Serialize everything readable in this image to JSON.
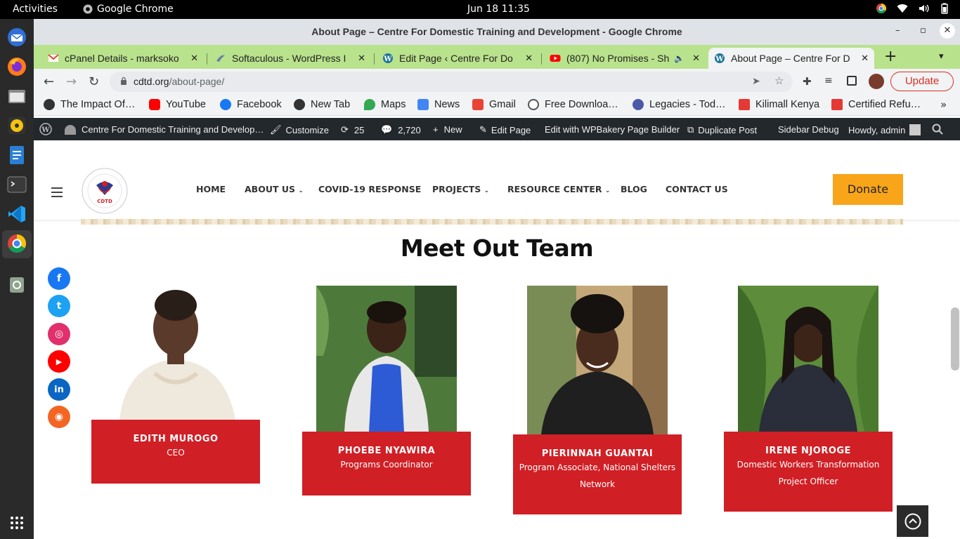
{
  "system": {
    "activities": "Activities",
    "app_name": "Google Chrome",
    "clock": "Jun 18  11:35"
  },
  "window": {
    "title": "About Page – Centre For Domestic Training and Development - Google Chrome"
  },
  "tabs": [
    {
      "label": "cPanel Details - marksoko",
      "icon": "gmail-icon",
      "color": "#ea4335"
    },
    {
      "label": "Softaculous - WordPress I",
      "icon": "softaculous-icon",
      "color": "#6b7fa8"
    },
    {
      "label": "Edit Page ‹ Centre For Do",
      "icon": "wordpress-icon",
      "color": "#21759b"
    },
    {
      "label": "(807) No Promises - Sh",
      "icon": "youtube-icon",
      "color": "#ff0000"
    },
    {
      "label": "About Page – Centre For D",
      "icon": "wordpress-icon",
      "color": "#21759b"
    }
  ],
  "toolbar": {
    "url_host": "cdtd.org",
    "url_path": "/about-page/",
    "update_label": "Update"
  },
  "bookmarks": [
    {
      "label": "The Impact Of…",
      "icon": "globe-icon",
      "color": "#333333"
    },
    {
      "label": "YouTube",
      "icon": "youtube-icon",
      "color": "#ff0000"
    },
    {
      "label": "Facebook",
      "icon": "facebook-icon",
      "color": "#1877f2"
    },
    {
      "label": "New Tab",
      "icon": "globe-icon",
      "color": "#333333"
    },
    {
      "label": "Maps",
      "icon": "maps-icon",
      "color": "#34a853"
    },
    {
      "label": "News",
      "icon": "news-icon",
      "color": "#4285f4"
    },
    {
      "label": "Gmail",
      "icon": "gmail-icon",
      "color": "#ea4335"
    },
    {
      "label": "Free Downloa…",
      "icon": "film-icon",
      "color": "#555555"
    },
    {
      "label": "Legacies - Tod…",
      "icon": "legacies-icon",
      "color": "#4a5aa8"
    },
    {
      "label": "Kilimall Kenya",
      "icon": "kilimall-icon",
      "color": "#e53935"
    },
    {
      "label": "Certified Refu…",
      "icon": "kilimall-icon",
      "color": "#e53935"
    }
  ],
  "wpbar": {
    "site_name": "Centre For Domestic Training and Develop…",
    "customize": "Customize",
    "updates": "25",
    "comments": "2,720",
    "new": "New",
    "edit_page": "Edit Page",
    "wpbakery": "Edit with WPBakery Page Builder",
    "duplicate": "Duplicate Post",
    "sidebar_debug": "Sidebar Debug",
    "howdy": "Howdy, admin"
  },
  "site": {
    "logo_text": "CDTD",
    "logo_ring_text": "Centre for Domestic Training and Development",
    "menu": [
      "HOME",
      "ABOUT US",
      "COVID-19 RESPONSE",
      "PROJECTS",
      "RESOURCE CENTER",
      "BLOG",
      "CONTACT US"
    ],
    "donate": "Donate",
    "team_title": "Meet Out Team",
    "social": [
      {
        "name": "facebook-icon",
        "glyph": "f",
        "color": "#1877f2"
      },
      {
        "name": "twitter-icon",
        "glyph": "t",
        "color": "#1da1f2"
      },
      {
        "name": "instagram-icon",
        "glyph": "◎",
        "color": "#e1306c"
      },
      {
        "name": "youtube-icon",
        "glyph": "▶",
        "color": "#ff0000"
      },
      {
        "name": "linkedin-icon",
        "glyph": "in",
        "color": "#0a66c2"
      },
      {
        "name": "rss-icon",
        "glyph": "◉",
        "color": "#f26522"
      }
    ],
    "team": [
      {
        "name": "EDITH MUROGO",
        "role": "CEO"
      },
      {
        "name": "PHOEBE NYAWIRA",
        "role": "Programs Coordinator"
      },
      {
        "name": "PIERINNAH GUANTAI",
        "role": "Program Associate, National Shelters Network"
      },
      {
        "name": "IRENE NJOROGE",
        "role": "Domestic Workers Transformation Project Officer"
      }
    ]
  },
  "colors": {
    "accent_red": "#d01f25",
    "donate_orange": "#f9a51a",
    "tabstrip_green": "#b9e28c"
  }
}
